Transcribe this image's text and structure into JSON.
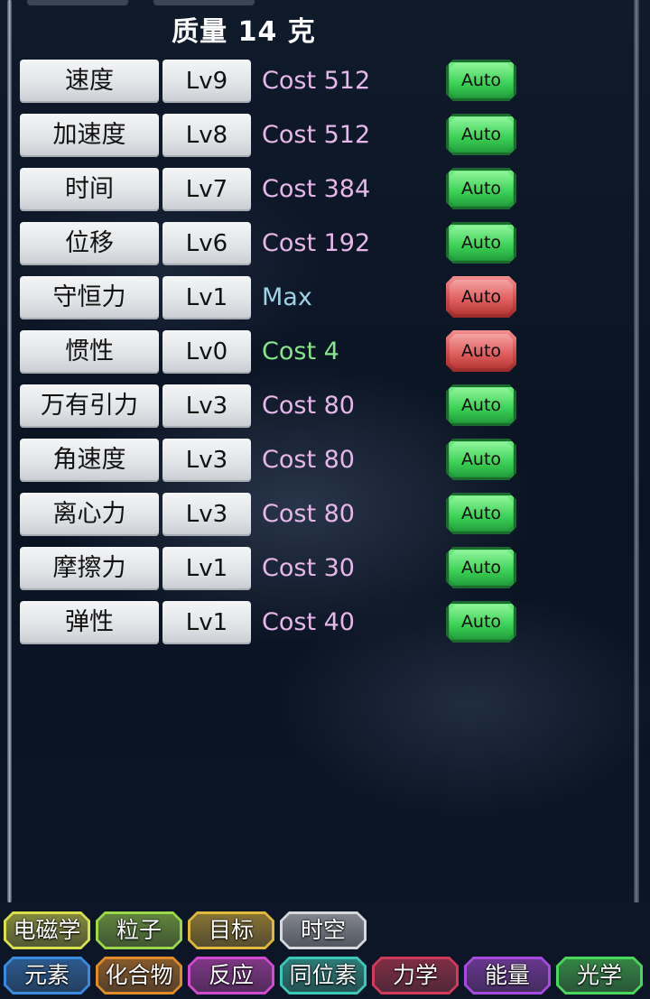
{
  "header": {
    "title": "质量 14 克"
  },
  "upgrades": [
    {
      "name": "速度",
      "level": "Lv9",
      "cost": "Cost 512",
      "cost_color": "#e7b7ea",
      "auto": "Auto",
      "auto_state": "on"
    },
    {
      "name": "加速度",
      "level": "Lv8",
      "cost": "Cost 512",
      "cost_color": "#e7b7ea",
      "auto": "Auto",
      "auto_state": "on"
    },
    {
      "name": "时间",
      "level": "Lv7",
      "cost": "Cost 384",
      "cost_color": "#e7b7ea",
      "auto": "Auto",
      "auto_state": "on"
    },
    {
      "name": "位移",
      "level": "Lv6",
      "cost": "Cost 192",
      "cost_color": "#e7b7ea",
      "auto": "Auto",
      "auto_state": "on"
    },
    {
      "name": "守恒力",
      "level": "Lv1",
      "cost": "Max",
      "cost_color": "#9fd2e6",
      "auto": "Auto",
      "auto_state": "off"
    },
    {
      "name": "惯性",
      "level": "Lv0",
      "cost": "Cost 4",
      "cost_color": "#86e68a",
      "auto": "Auto",
      "auto_state": "off"
    },
    {
      "name": "万有引力",
      "level": "Lv3",
      "cost": "Cost 80",
      "cost_color": "#e7b7ea",
      "auto": "Auto",
      "auto_state": "on"
    },
    {
      "name": "角速度",
      "level": "Lv3",
      "cost": "Cost 80",
      "cost_color": "#e7b7ea",
      "auto": "Auto",
      "auto_state": "on"
    },
    {
      "name": "离心力",
      "level": "Lv3",
      "cost": "Cost 80",
      "cost_color": "#e7b7ea",
      "auto": "Auto",
      "auto_state": "on"
    },
    {
      "name": "摩擦力",
      "level": "Lv1",
      "cost": "Cost 30",
      "cost_color": "#e7b7ea",
      "auto": "Auto",
      "auto_state": "on"
    },
    {
      "name": "弹性",
      "level": "Lv1",
      "cost": "Cost 40",
      "cost_color": "#e7b7ea",
      "auto": "Auto",
      "auto_state": "on"
    }
  ],
  "nav_row1": [
    {
      "label": "电磁学",
      "color": "#d8e04a"
    },
    {
      "label": "粒子",
      "color": "#9ad84a"
    },
    {
      "label": "目标",
      "color": "#e0b83a"
    },
    {
      "label": "时空",
      "color": "#d6d8dc"
    }
  ],
  "nav_row2": [
    {
      "label": "元素",
      "color": "#3a8ae0"
    },
    {
      "label": "化合物",
      "color": "#e08a2a"
    },
    {
      "label": "反应",
      "color": "#d24ad0"
    },
    {
      "label": "同位素",
      "color": "#3ac8b8"
    },
    {
      "label": "力学",
      "color": "#d23a5a"
    },
    {
      "label": "能量",
      "color": "#a84ae0"
    },
    {
      "label": "光学",
      "color": "#4ad85a"
    }
  ]
}
